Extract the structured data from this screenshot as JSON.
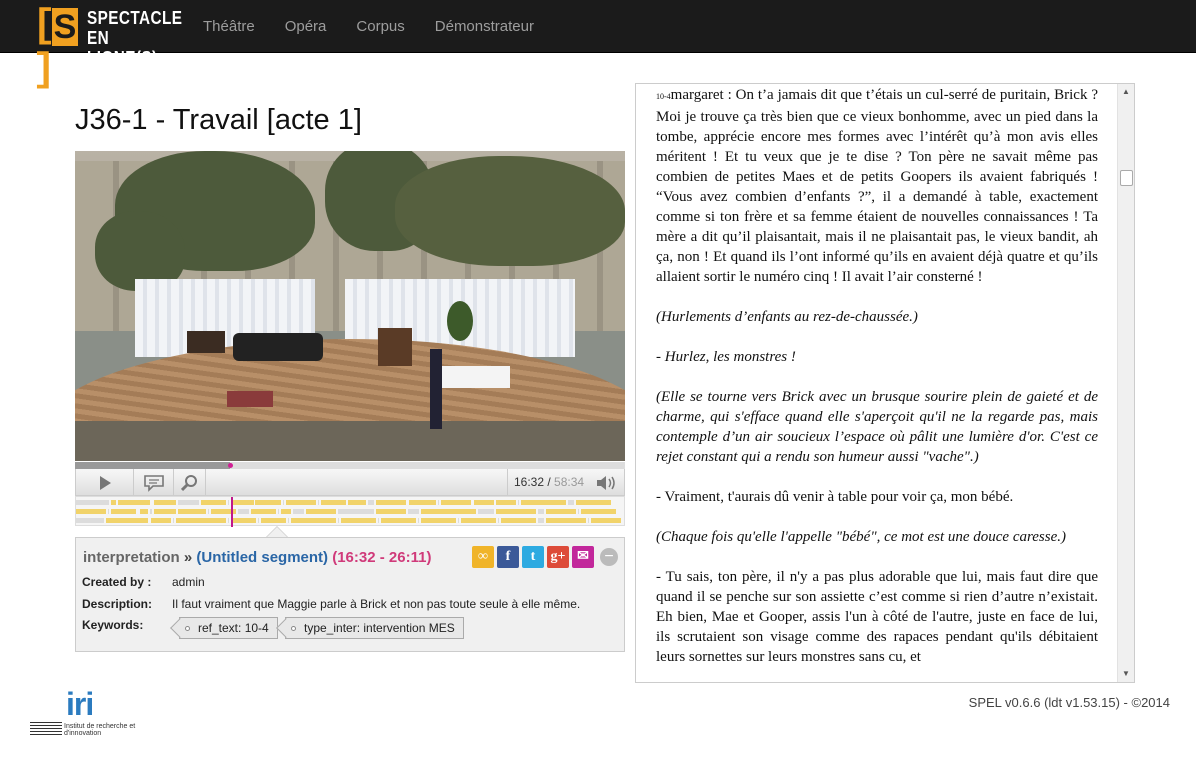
{
  "nav": {
    "logo_mark": "[S]",
    "logo_line1": "SPECTACLE",
    "logo_line2": "EN LIGNE(S)",
    "links": [
      "Théâtre",
      "Opéra",
      "Corpus",
      "Démonstrateur"
    ]
  },
  "page": {
    "title": "J36-1 - Travail [acte 1]"
  },
  "player": {
    "current_time": "16:32",
    "separator": " / ",
    "total_time": "58:34",
    "progress": 0.282,
    "icons": {
      "play": "play-icon",
      "annotate": "speech-bubble-icon",
      "search": "magnifier-icon",
      "volume": "speaker-icon"
    }
  },
  "annotation": {
    "type": "interpretation",
    "separator": "»",
    "segment": "(Untitled segment)",
    "timecode": "(16:32 - 26:11)",
    "created_by_label": "Created by :",
    "created_by_value": "admin",
    "description_label": "Description:",
    "description_value": "Il faut vraiment que Maggie parle à Brick et non pas toute seule à elle même.",
    "keywords_label": "Keywords:",
    "keywords": [
      "ref_text: 10-4",
      "type_inter: intervention MES"
    ],
    "share_icons": [
      "link-icon",
      "facebook-icon",
      "twitter-icon",
      "google-plus-icon",
      "email-icon",
      "close-icon"
    ],
    "share_glyphs": [
      "∞",
      "f",
      "t",
      "g+",
      "✉",
      "−"
    ],
    "share_colors": [
      "#f0b429",
      "#3b5998",
      "#2daae1",
      "#dd4b39",
      "#c2279b",
      "#bbbbbb"
    ]
  },
  "text": {
    "ref": "10-4",
    "paragraphs": [
      {
        "italic": false,
        "text": "margaret : On t’a jamais dit que t’étais un cul-serré de puritain, Brick ? Moi je trouve ça très bien que ce vieux bonhomme, avec un pied dans la tombe, apprécie encore mes formes avec l’intérêt qu’à mon avis elles méritent ! Et tu veux que je te dise ? Ton père ne savait même pas combien de petites Maes et de petits Goopers ils avaient fabriqués ! “Vous avez combien d’enfants ?”, il a demandé à table, exactement comme si ton frère et sa femme étaient de nouvelles connaissances ! Ta mère a dit qu’il plaisantait, mais il ne plaisantait pas, le vieux bandit, ah ça, non ! Et quand ils l’ont informé qu’ils en avaient déjà quatre et qu’ils allaient sortir le numéro cinq ! Il avait l’air consterné !"
      },
      {
        "italic": true,
        "text": "(Hurlements d’enfants au rez-de-chaussée.)"
      },
      {
        "italic": true,
        "text": "- Hurlez, les monstres !"
      },
      {
        "italic": true,
        "text": "(Elle se tourne vers Brick avec un brusque sourire plein de gaieté et de charme, qui s'efface quand elle s'aperçoit qu'il ne la regarde pas, mais contemple d’un air soucieux l’espace où pâlit une lumière d'or. C'est ce rejet constant qui a rendu son humeur aussi \"vache\".)"
      },
      {
        "italic": false,
        "text": "- Vraiment, t'aurais dû venir à table pour voir ça, mon bébé."
      },
      {
        "italic": true,
        "text": "(Chaque fois qu'elle l'appelle \"bébé\", ce mot est une douce caresse.)"
      },
      {
        "italic": false,
        "text": "- Tu sais, ton père, il n'y a pas plus adorable que lui, mais faut dire que quand il se penche sur son assiette c’est comme si rien d’autre n’existait. Eh bien, Mae et Gooper, assis l'un à côté de l'autre, juste en face de lui, ils scrutaient son visage comme des rapaces pendant qu'ils débitaient leurs sornettes sur leurs monstres sans cu, et"
      }
    ]
  },
  "footer": {
    "version": "SPEL v0.6.6 (ldt v1.53.15) - ©2014",
    "iri_big": "iri",
    "iri_sub": "Institut de recherche et d'innovation"
  }
}
